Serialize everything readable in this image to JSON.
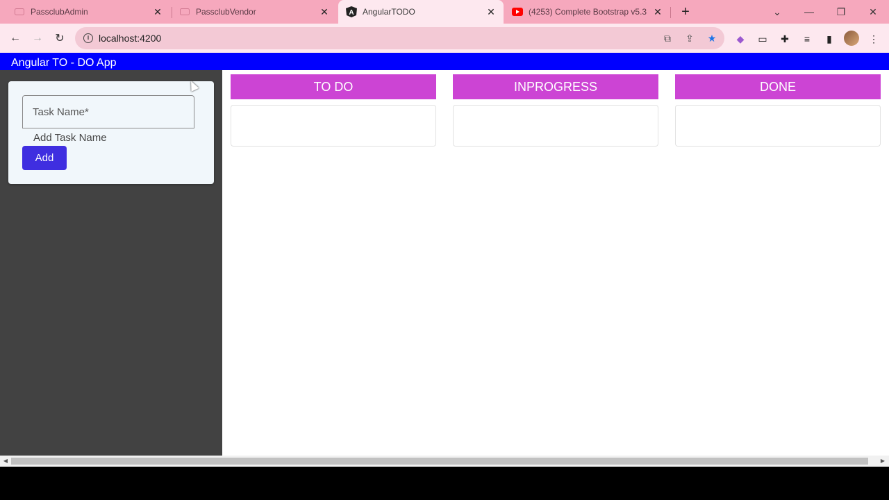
{
  "browser": {
    "tabs": [
      {
        "title": "PassclubAdmin",
        "favicon": "passclub-icon"
      },
      {
        "title": "PassclubVendor",
        "favicon": "passclub-icon"
      },
      {
        "title": "AngularTODO",
        "favicon": "angular-icon",
        "active": true
      },
      {
        "title": "(4253) Complete Bootstrap v5.3",
        "favicon": "youtube-icon"
      }
    ],
    "address": "localhost:4200",
    "colors": {
      "tabstrip": "#f6a8bd",
      "toolbar": "#fde8ef",
      "omnibox": "#f3c9d5"
    }
  },
  "app": {
    "header_title": "Angular TO - DO App",
    "form": {
      "input_placeholder": "Task Name*",
      "hint": "Add Task Name",
      "add_label": "Add"
    },
    "columns": [
      {
        "title": "TO DO"
      },
      {
        "title": "INPROGRESS"
      },
      {
        "title": "DONE"
      }
    ],
    "colors": {
      "header": "#0000ff",
      "column_header": "#cc44d4",
      "add_button": "#3f2ee0",
      "sidebar": "#424242"
    }
  }
}
